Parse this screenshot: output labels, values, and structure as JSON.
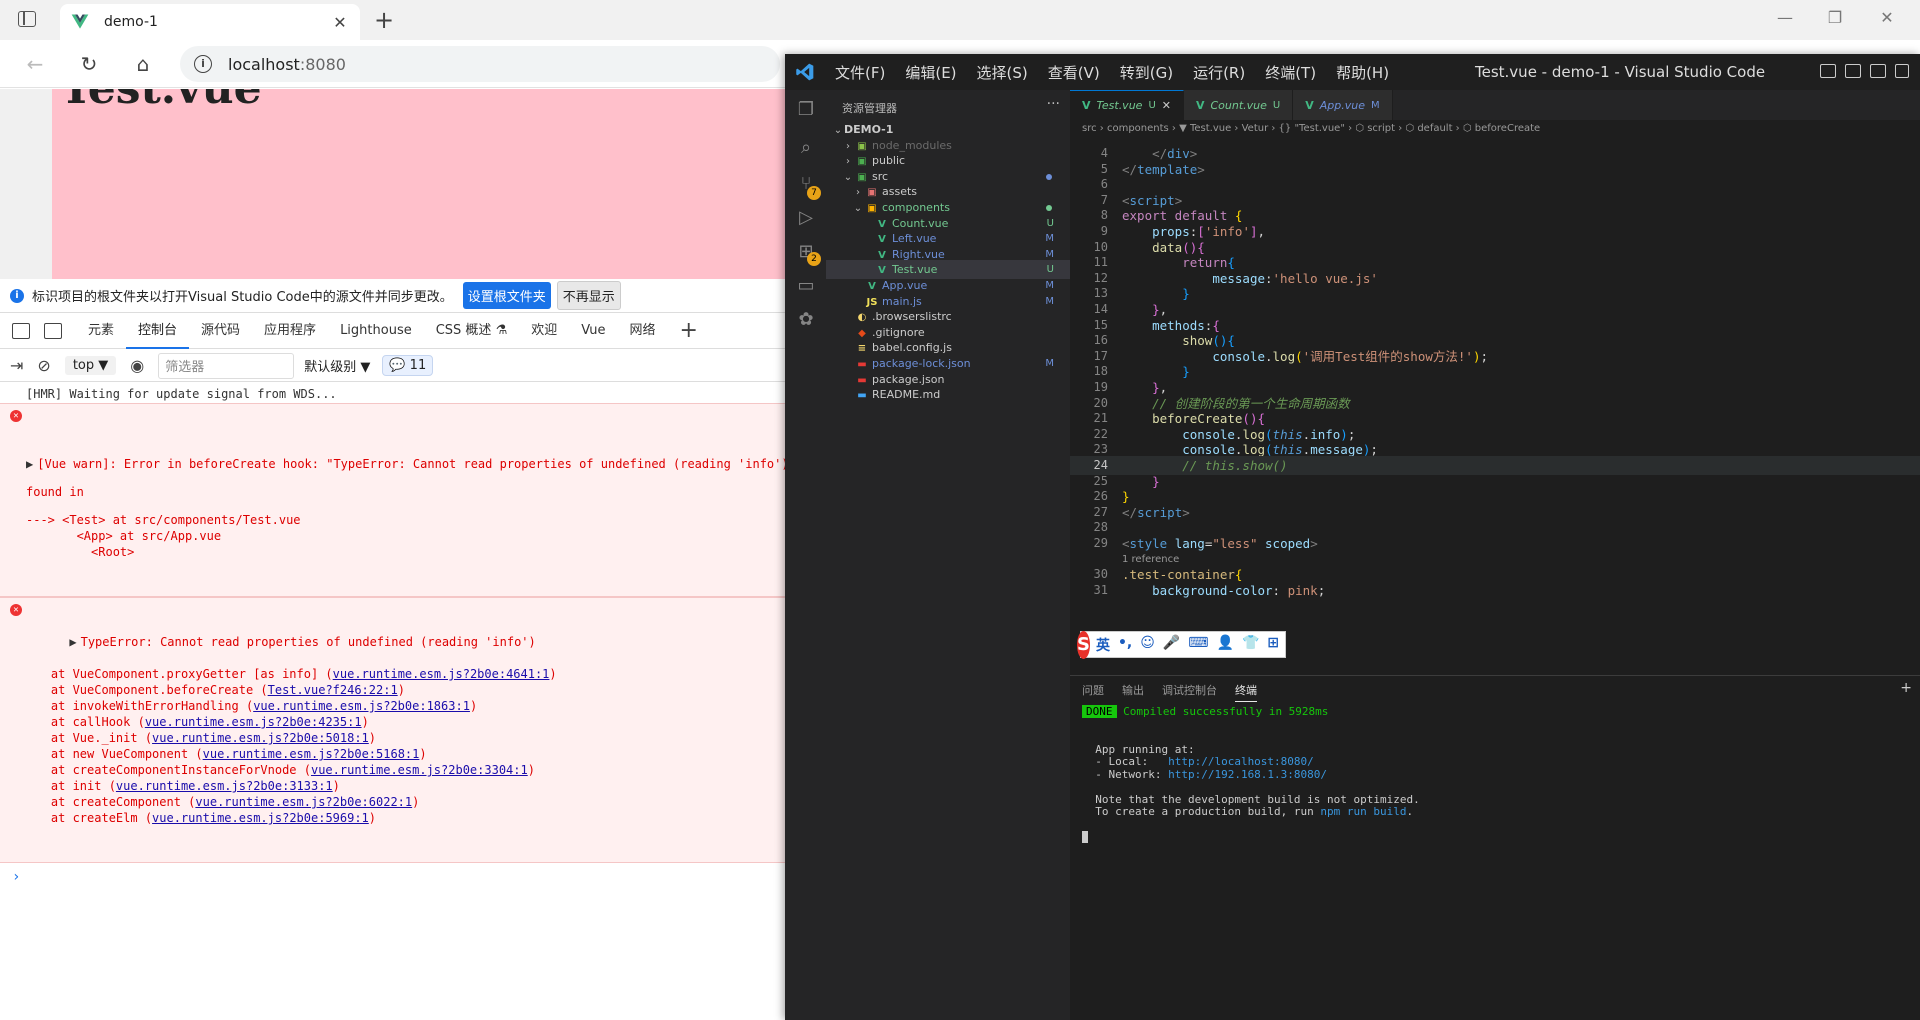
{
  "browser": {
    "tab_title": "demo-1",
    "url_host": "localhost",
    "url_port": ":8080",
    "win_min": "—",
    "win_max": "❐",
    "win_close": "✕",
    "back": "←",
    "reload": "↻",
    "home": "⌂"
  },
  "page": {
    "title": "Test.vue"
  },
  "devtools": {
    "infobar": {
      "text": "标识项目的根文件夹以打开Visual Studio Code中的源文件并同步更改。",
      "primary": "设置根文件夹",
      "secondary": "不再显示"
    },
    "tabs": [
      "元素",
      "控制台",
      "源代码",
      "应用程序",
      "Lighthouse",
      "CSS 概述 ⚗",
      "欢迎",
      "Vue",
      "网络"
    ],
    "active_tab": 1,
    "toolbar": {
      "context": "top ▼",
      "filter_placeholder": "筛选器",
      "level": "默认级别 ▼",
      "badge": "💬 11"
    },
    "console": {
      "hmr": "[HMR] Waiting for update signal from WDS...",
      "warn_lines": [
        "[Vue warn]: Error in beforeCreate hook: \"TypeError: Cannot read properties of undefined (reading 'info')\"",
        "",
        "found in",
        "",
        "---> <Test> at src/components/Test.vue",
        "       <App> at src/App.vue",
        "         <Root>"
      ],
      "error_head": "TypeError: Cannot read properties of undefined (reading 'info')",
      "stack": [
        {
          "pre": "    at VueComponent.proxyGetter [as info] (",
          "link": "vue.runtime.esm.js?2b0e:4641:1",
          "post": ")"
        },
        {
          "pre": "    at VueComponent.beforeCreate (",
          "link": "Test.vue?f246:22:1",
          "post": ")"
        },
        {
          "pre": "    at invokeWithErrorHandling (",
          "link": "vue.runtime.esm.js?2b0e:1863:1",
          "post": ")"
        },
        {
          "pre": "    at callHook (",
          "link": "vue.runtime.esm.js?2b0e:4235:1",
          "post": ")"
        },
        {
          "pre": "    at Vue._init (",
          "link": "vue.runtime.esm.js?2b0e:5018:1",
          "post": ")"
        },
        {
          "pre": "    at new VueComponent (",
          "link": "vue.runtime.esm.js?2b0e:5168:1",
          "post": ")"
        },
        {
          "pre": "    at createComponentInstanceForVnode (",
          "link": "vue.runtime.esm.js?2b0e:3304:1",
          "post": ")"
        },
        {
          "pre": "    at init (",
          "link": "vue.runtime.esm.js?2b0e:3133:1",
          "post": ")"
        },
        {
          "pre": "    at createComponent (",
          "link": "vue.runtime.esm.js?2b0e:6022:1",
          "post": ")"
        },
        {
          "pre": "    at createElm (",
          "link": "vue.runtime.esm.js?2b0e:5969:1",
          "post": ")"
        }
      ],
      "prompt": "›"
    }
  },
  "vscode": {
    "menus": [
      "文件(F)",
      "编辑(E)",
      "选择(S)",
      "查看(V)",
      "转到(G)",
      "运行(R)",
      "终端(T)",
      "帮助(H)"
    ],
    "window_title": "Test.vue - demo-1 - Visual Studio Code",
    "explorer_title": "资源管理器",
    "explorer_more": "···",
    "tree": [
      {
        "name": "DEMO-1",
        "depth": 0,
        "chev": "⌄",
        "icon": "",
        "color": "#cccccc",
        "badge": "",
        "bold": true
      },
      {
        "name": "node_modules",
        "depth": 1,
        "chev": "›",
        "icon": "▣",
        "iconColor": "#8bc34a",
        "color": "#6b6b6b",
        "badge": ""
      },
      {
        "name": "public",
        "depth": 1,
        "chev": "›",
        "icon": "▣",
        "iconColor": "#4caf50",
        "color": "#cccccc",
        "badge": ""
      },
      {
        "name": "src",
        "depth": 1,
        "chev": "⌄",
        "icon": "▣",
        "iconColor": "#4caf50",
        "color": "#cccccc",
        "badge": "",
        "dot": "blue"
      },
      {
        "name": "assets",
        "depth": 2,
        "chev": "›",
        "icon": "▣",
        "iconColor": "#e57373",
        "color": "#cccccc",
        "badge": ""
      },
      {
        "name": "components",
        "depth": 2,
        "chev": "⌄",
        "icon": "▣",
        "iconColor": "#ffb300",
        "color": "#73c991",
        "badge": "",
        "dot": "green"
      },
      {
        "name": "Count.vue",
        "depth": 3,
        "chev": "",
        "icon": "V",
        "iconColor": "#41b883",
        "color": "#73c991",
        "badge": "U",
        "badgeColor": "#73c991"
      },
      {
        "name": "Left.vue",
        "depth": 3,
        "chev": "",
        "icon": "V",
        "iconColor": "#41b883",
        "color": "#6d8fd8",
        "badge": "M",
        "badgeColor": "#6d8fd8"
      },
      {
        "name": "Right.vue",
        "depth": 3,
        "chev": "",
        "icon": "V",
        "iconColor": "#41b883",
        "color": "#6d8fd8",
        "badge": "M",
        "badgeColor": "#6d8fd8"
      },
      {
        "name": "Test.vue",
        "depth": 3,
        "chev": "",
        "icon": "V",
        "iconColor": "#41b883",
        "color": "#73c991",
        "badge": "U",
        "badgeColor": "#73c991",
        "selected": true
      },
      {
        "name": "App.vue",
        "depth": 2,
        "chev": "",
        "icon": "V",
        "iconColor": "#41b883",
        "color": "#6d8fd8",
        "badge": "M",
        "badgeColor": "#6d8fd8"
      },
      {
        "name": "main.js",
        "depth": 2,
        "chev": "",
        "icon": "JS",
        "iconColor": "#f1e05a",
        "color": "#6d8fd8",
        "badge": "M",
        "badgeColor": "#6d8fd8"
      },
      {
        "name": ".browserslistrc",
        "depth": 1,
        "chev": "",
        "icon": "◐",
        "iconColor": "#f5d76e",
        "color": "#cccccc",
        "badge": ""
      },
      {
        "name": ".gitignore",
        "depth": 1,
        "chev": "",
        "icon": "◆",
        "iconColor": "#e64a19",
        "color": "#cccccc",
        "badge": ""
      },
      {
        "name": "babel.config.js",
        "depth": 1,
        "chev": "",
        "icon": "≡",
        "iconColor": "#f5d76e",
        "color": "#cccccc",
        "badge": ""
      },
      {
        "name": "package-lock.json",
        "depth": 1,
        "chev": "",
        "icon": "▬",
        "iconColor": "#e53935",
        "color": "#6d8fd8",
        "badge": "M",
        "badgeColor": "#6d8fd8"
      },
      {
        "name": "package.json",
        "depth": 1,
        "chev": "",
        "icon": "▬",
        "iconColor": "#e53935",
        "color": "#cccccc",
        "badge": ""
      },
      {
        "name": "README.md",
        "depth": 1,
        "chev": "",
        "icon": "▬",
        "iconColor": "#42a5f5",
        "color": "#cccccc",
        "badge": ""
      }
    ],
    "editor_tabs": [
      {
        "label": "Test.vue",
        "status": "U",
        "active": true,
        "close": "✕"
      },
      {
        "label": "Count.vue",
        "status": "U",
        "active": false,
        "close": ""
      },
      {
        "label": "App.vue",
        "status": "M",
        "active": false,
        "close": ""
      }
    ],
    "breadcrumb": "src › components › ▼ Test.vue › Vetur › {} \"Test.vue\" › ⬡ script › ⬡ default › ⬡ beforeCreate",
    "code": [
      {
        "n": "4",
        "html": "    <span class='t-tag'>&lt;/</span><span class='t-tagn'>div</span><span class='t-tag'>&gt;</span>"
      },
      {
        "n": "5",
        "html": "<span class='t-tag'>&lt;/</span><span class='t-tagn'>template</span><span class='t-tag'>&gt;</span>"
      },
      {
        "n": "6",
        "html": ""
      },
      {
        "n": "7",
        "html": "<span class='t-tag'>&lt;</span><span class='t-tagn'>script</span><span class='t-tag'>&gt;</span>"
      },
      {
        "n": "8",
        "html": "<span class='t-kw'>export default</span> <span class='t-brace'>{</span>"
      },
      {
        "n": "9",
        "html": "    <span class='t-var'>props</span><span class='t-plain'>:</span><span class='t-brace2'>[</span><span class='t-str'>'info'</span><span class='t-brace2'>]</span><span class='t-plain'>,</span>"
      },
      {
        "n": "10",
        "html": "    <span class='t-fn'>data</span><span class='t-brace2'>()</span><span class='t-brace2'>{</span>"
      },
      {
        "n": "11",
        "html": "        <span class='t-kw'>return</span><span class='t-brace3'>{</span>"
      },
      {
        "n": "12",
        "html": "            <span class='t-var'>message</span><span class='t-plain'>:</span><span class='t-str'>'hello vue.js'</span>"
      },
      {
        "n": "13",
        "html": "        <span class='t-brace3'>}</span>"
      },
      {
        "n": "14",
        "html": "    <span class='t-brace2'>}</span><span class='t-plain'>,</span>"
      },
      {
        "n": "15",
        "html": "    <span class='t-var'>methods</span><span class='t-plain'>:</span><span class='t-brace2'>{</span>"
      },
      {
        "n": "16",
        "html": "        <span class='t-fn'>show</span><span class='t-brace3'>()</span><span class='t-brace3'>{</span>"
      },
      {
        "n": "17",
        "html": "            <span class='t-var'>console</span><span class='t-plain'>.</span><span class='t-fn'>log</span><span class='t-brace'>(</span><span class='t-str'>'调用Test组件的show方法!'</span><span class='t-brace'>)</span><span class='t-plain'>;</span>"
      },
      {
        "n": "18",
        "html": "        <span class='t-brace3'>}</span>"
      },
      {
        "n": "19",
        "html": "    <span class='t-brace2'>}</span><span class='t-plain'>,</span>"
      },
      {
        "n": "20",
        "html": "    <span class='t-cm'>// 创建阶段的第一个生命周期函数</span>"
      },
      {
        "n": "21",
        "html": "    <span class='t-fn'>beforeCreate</span><span class='t-brace2'>()</span><span class='t-brace2'>{</span>"
      },
      {
        "n": "22",
        "html": "        <span class='t-var'>console</span><span class='t-plain'>.</span><span class='t-fn'>log</span><span class='t-brace3'>(</span><span class='t-this'>this</span><span class='t-plain'>.</span><span class='t-var'>info</span><span class='t-brace3'>)</span><span class='t-plain'>;</span>"
      },
      {
        "n": "23",
        "html": "        <span class='t-var'>console</span><span class='t-plain'>.</span><span class='t-fn'>log</span><span class='t-brace3'>(</span><span class='t-this'>this</span><span class='t-plain'>.</span><span class='t-var'>message</span><span class='t-brace3'>)</span><span class='t-plain'>;</span>"
      },
      {
        "n": "24",
        "html": "        <span class='t-cm'>// this.show()</span>",
        "current": true
      },
      {
        "n": "25",
        "html": "    <span class='t-brace2'>}</span>"
      },
      {
        "n": "26",
        "html": "<span class='t-brace'>}</span>"
      },
      {
        "n": "27",
        "html": "<span class='t-tag'>&lt;/</span><span class='t-tagn'>script</span><span class='t-tag'>&gt;</span>"
      },
      {
        "n": "28",
        "html": ""
      },
      {
        "n": "29",
        "html": "<span class='t-tag'>&lt;</span><span class='t-tagn'>style</span> <span class='t-attr'>lang</span><span class='t-plain'>=</span><span class='t-str'>\"less\"</span> <span class='t-attr'>scoped</span><span class='t-tag'>&gt;</span>"
      },
      {
        "n": "",
        "html": "",
        "hint": "1 reference"
      },
      {
        "n": "30",
        "html": "<span class='t-sel'>.test-container</span><span class='t-brace'>{</span>"
      },
      {
        "n": "31",
        "html": "    <span class='t-var'>background-color</span><span class='t-plain'>: </span><span class='t-str'>pink</span><span class='t-plain'>;</span>"
      }
    ],
    "panel_tabs": [
      "问题",
      "输出",
      "调试控制台",
      "终端"
    ],
    "panel_active": 3,
    "terminal": {
      "done": "DONE",
      "compiled": " Compiled successfully in 5928ms",
      "running": "  App running at:",
      "local_label": "  - Local:   ",
      "local_url": "http://localhost:8080/",
      "network_label": "  - Network: ",
      "network_url": "http://192.168.1.3:8080/",
      "note1": "  Note that the development build is not optimized.",
      "note2_pre": "  To create a production build, run ",
      "note2_cmd": "npm run build",
      "note2_post": "."
    },
    "ime": {
      "logo": "S",
      "items": [
        "英",
        "•,",
        "☺",
        "🎤",
        "⌨",
        "👤",
        "👕",
        "⊞"
      ]
    }
  }
}
